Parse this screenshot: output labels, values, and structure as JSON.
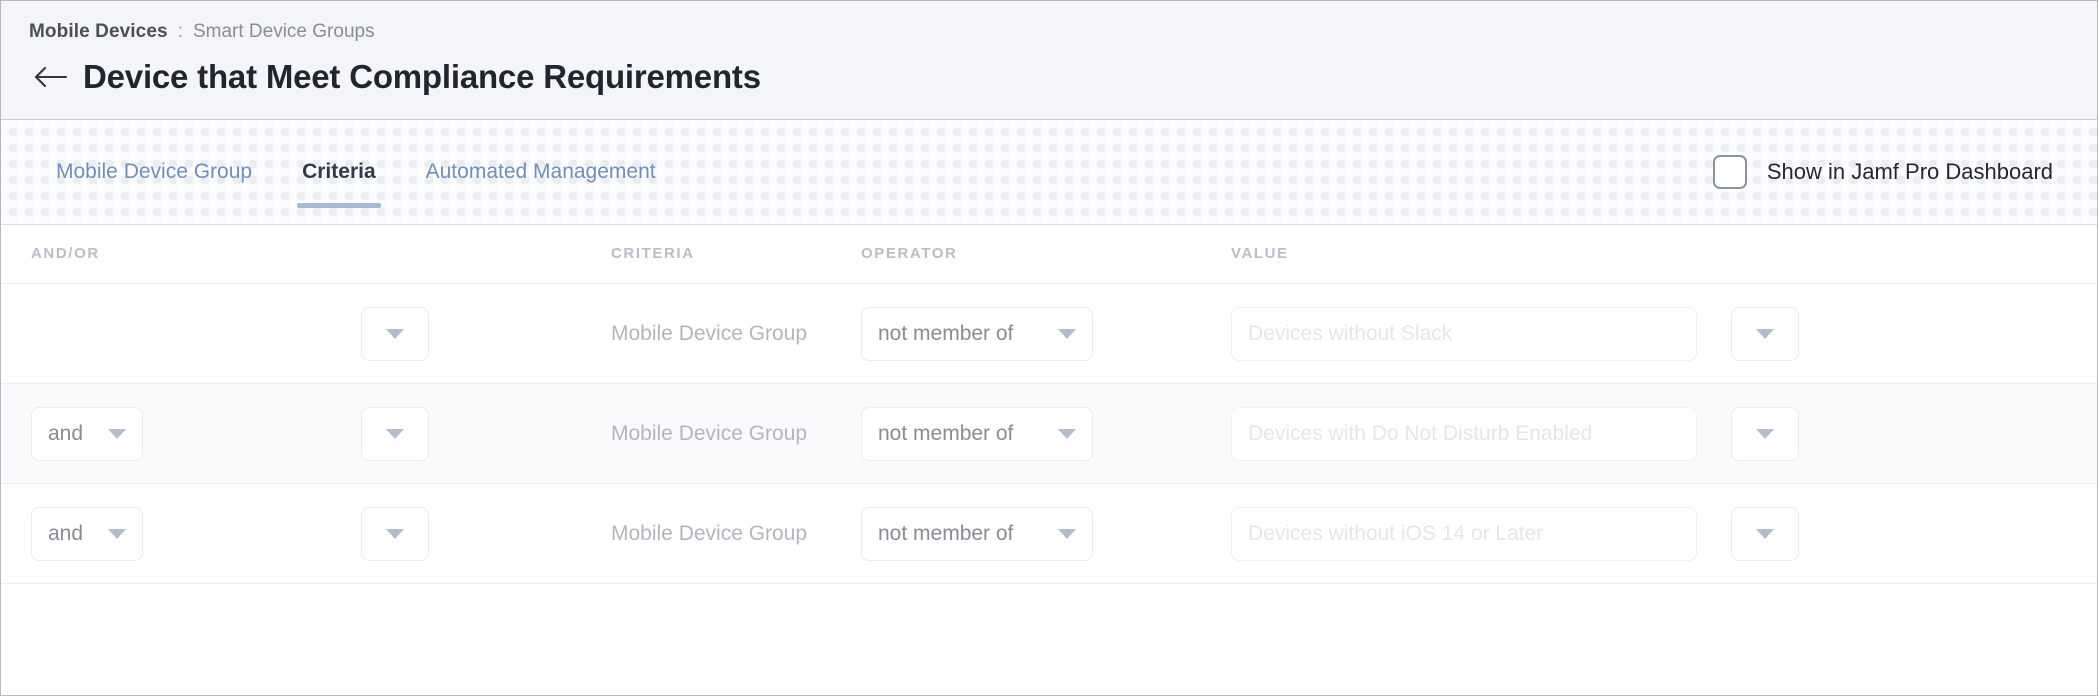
{
  "header": {
    "breadcrumb": {
      "parent": "Mobile Devices",
      "separator": ":",
      "current": "Smart Device Groups"
    },
    "back_icon": "arrow-left-icon",
    "title": "Device that Meet Compliance Requirements"
  },
  "tabs": [
    {
      "label": "Mobile Device Group",
      "active": false
    },
    {
      "label": "Criteria",
      "active": true
    },
    {
      "label": "Automated Management",
      "active": false
    }
  ],
  "dashboard_checkbox": {
    "label": "Show in Jamf Pro Dashboard",
    "checked": false
  },
  "table": {
    "columns": {
      "andor": "AND/OR",
      "criteria": "CRITERIA",
      "operator": "OPERATOR",
      "value": "VALUE"
    },
    "rows": [
      {
        "andor": "",
        "select_blank": "",
        "criteria": "Mobile Device Group",
        "operator": "not member of",
        "value": "Devices without Slack",
        "extra": ""
      },
      {
        "andor": "and",
        "select_blank": "",
        "criteria": "Mobile Device Group",
        "operator": "not member of",
        "value": "Devices with Do Not Disturb Enabled",
        "extra": ""
      },
      {
        "andor": "and",
        "select_blank": "",
        "criteria": "Mobile Device Group",
        "operator": "not member of",
        "value": "Devices without iOS 14 or Later",
        "extra": ""
      }
    ]
  },
  "colors": {
    "header_bg": "#f4f5f9",
    "tab_active_text": "#2f3a4c",
    "tab_inactive_text": "#6d8fc0",
    "tab_underline": "#a1bbd8",
    "column_header_text": "#b9bdc9",
    "placeholder_text": "#e4e6ea"
  }
}
